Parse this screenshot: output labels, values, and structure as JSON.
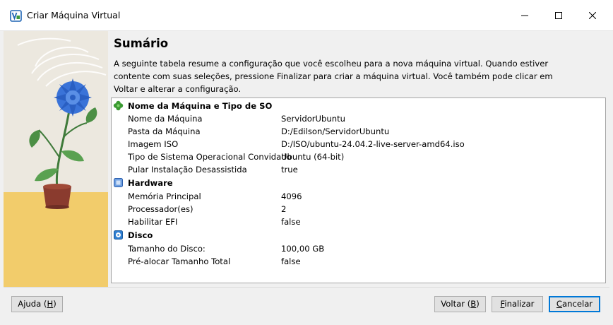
{
  "window": {
    "title": "Criar Máquina Virtual"
  },
  "page": {
    "heading": "Sumário",
    "description": "A seguinte tabela resume a configuração que você escolheu para a nova máquina virtual. Quando estiver contente com suas seleções, pressione Finalizar para criar a máquina virtual. Você também pode clicar em Voltar e alterar a configuração."
  },
  "summary": {
    "sections": [
      {
        "title": "Nome da Máquina e Tipo de SO",
        "icon": "clover-icon",
        "rows": [
          {
            "key": "Nome da Máquina",
            "value": "ServidorUbuntu"
          },
          {
            "key": "Pasta da Máquina",
            "value": "D:/Edilson/ServidorUbuntu"
          },
          {
            "key": "Imagem ISO",
            "value": "D:/ISO/ubuntu-24.04.2-live-server-amd64.iso"
          },
          {
            "key": "Tipo de Sistema Operacional Convidado",
            "value": "Ubuntu (64-bit)"
          },
          {
            "key": "Pular Instalação Desassistida",
            "value": "true"
          }
        ]
      },
      {
        "title": "Hardware",
        "icon": "chip-icon",
        "rows": [
          {
            "key": "Memória Principal",
            "value": "4096"
          },
          {
            "key": "Processador(es)",
            "value": "2"
          },
          {
            "key": "Habilitar EFI",
            "value": "false"
          }
        ]
      },
      {
        "title": "Disco",
        "icon": "disk-icon",
        "rows": [
          {
            "key": "Tamanho do Disco:",
            "value": "100,00 GB"
          },
          {
            "key": "Pré-alocar Tamanho Total",
            "value": "false"
          }
        ]
      }
    ]
  },
  "buttons": {
    "help": {
      "pre": "Ajuda (",
      "mnemonic": "H",
      "post": ")"
    },
    "back": {
      "pre": "Voltar (",
      "mnemonic": "B",
      "post": ")"
    },
    "finish": {
      "pre": "",
      "mnemonic": "F",
      "post": "inalizar"
    },
    "cancel": {
      "pre": "",
      "mnemonic": "C",
      "post": "ancelar"
    }
  },
  "colors": {
    "accent": "#0078d7",
    "art_background": "#ece8df",
    "art_table": "#f2cc6b",
    "flower": "#3a73d8"
  }
}
